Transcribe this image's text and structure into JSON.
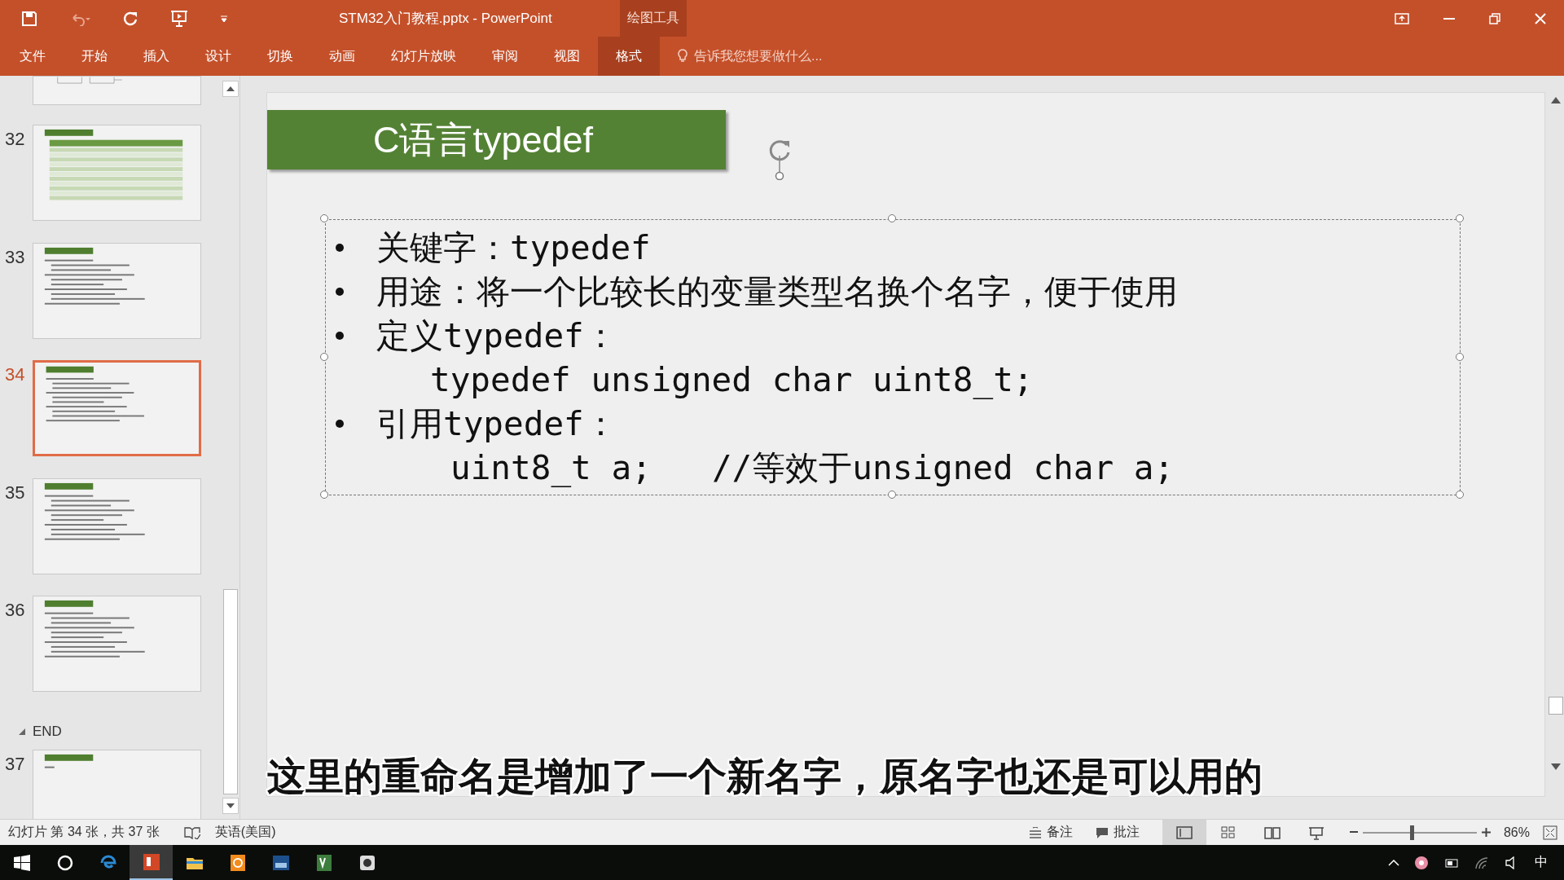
{
  "window": {
    "title": "STM32入门教程.pptx - PowerPoint",
    "context_group": "绘图工具"
  },
  "ribbon_tabs": [
    {
      "label": "文件",
      "selected": false
    },
    {
      "label": "开始",
      "selected": false
    },
    {
      "label": "插入",
      "selected": false
    },
    {
      "label": "设计",
      "selected": false
    },
    {
      "label": "切换",
      "selected": false
    },
    {
      "label": "动画",
      "selected": false
    },
    {
      "label": "幻灯片放映",
      "selected": false
    },
    {
      "label": "审阅",
      "selected": false
    },
    {
      "label": "视图",
      "selected": false
    },
    {
      "label": "格式",
      "selected": true
    }
  ],
  "tell_me": {
    "placeholder": "告诉我您想要做什么..."
  },
  "thumbnails": [
    {
      "kind": "diagram",
      "selected": false
    },
    {
      "number": "32",
      "kind": "table",
      "selected": false
    },
    {
      "number": "33",
      "kind": "text",
      "selected": false
    },
    {
      "number": "34",
      "kind": "text",
      "selected": true
    },
    {
      "number": "35",
      "kind": "text",
      "selected": false
    },
    {
      "number": "36",
      "kind": "text",
      "selected": false
    },
    {
      "section": "END",
      "expanded": true,
      "number": "37",
      "kind": "short",
      "selected": false
    }
  ],
  "slide": {
    "title": "C语言typedef",
    "lines": [
      {
        "kind": "bullet",
        "text": "关键字：typedef"
      },
      {
        "kind": "bullet",
        "text": "用途：将一个比较长的变量类型名换个名字，便于使用"
      },
      {
        "kind": "bullet",
        "text": "定义typedef："
      },
      {
        "kind": "code",
        "text": "typedef unsigned char uint8_t;"
      },
      {
        "kind": "bullet",
        "text": "引用typedef："
      },
      {
        "kind": "code2",
        "text": "uint8_t a;   //等效于unsigned char a;"
      }
    ]
  },
  "subtitle": "这里的重命名是增加了一个新名字，原名字也还是可以用的",
  "status_bar": {
    "slide_info": "幻灯片 第 34 张，共 37 张",
    "language": "英语(美国)",
    "notes": "备注",
    "comments": "批注",
    "views": [
      {
        "kind": "normal",
        "selected": true
      },
      {
        "kind": "sorter",
        "selected": false
      },
      {
        "kind": "reading",
        "selected": false
      },
      {
        "kind": "show",
        "selected": false
      }
    ],
    "zoom": {
      "level": 0.43,
      "reading": "86%"
    }
  },
  "taskbar": {
    "apps": [
      {
        "kind": "edge",
        "selected": false
      },
      {
        "kind": "powerpoint",
        "selected": true
      },
      {
        "kind": "folder",
        "selected": false
      },
      {
        "kind": "orange",
        "selected": false
      },
      {
        "kind": "ide",
        "selected": false
      },
      {
        "kind": "keil",
        "selected": false
      },
      {
        "kind": "camera",
        "selected": false
      }
    ],
    "input_method": "中"
  }
}
